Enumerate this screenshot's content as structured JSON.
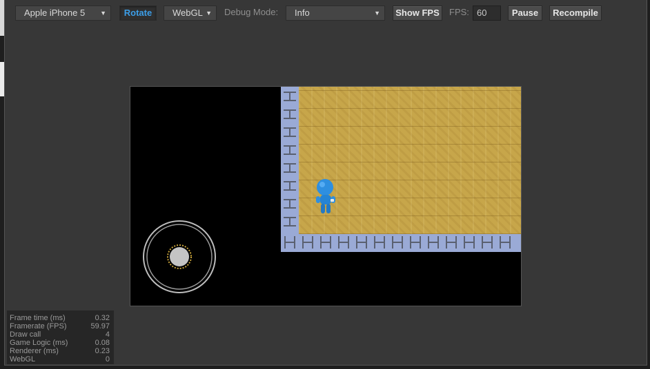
{
  "toolbar": {
    "device_select": "Apple iPhone 5",
    "rotate_label": "Rotate",
    "renderer_select": "WebGL",
    "debug_mode_label": "Debug Mode:",
    "debug_mode_select": "Info",
    "show_fps_label": "Show FPS",
    "fps_label": "FPS:",
    "fps_value": "60",
    "pause_label": "Pause",
    "recompile_label": "Recompile"
  },
  "colors": {
    "accent": "#3c9ee8",
    "floor": "#c7a64a",
    "wall": "#9aaad6",
    "character": "#2e8fe0"
  },
  "icons": {
    "dropdown": "triangle-down",
    "character": "blue-robot-character",
    "joystick": "virtual-joystick"
  },
  "stats": [
    {
      "label": "Frame time (ms)",
      "value": "0.32"
    },
    {
      "label": "Framerate (FPS)",
      "value": "59.97"
    },
    {
      "label": "Draw call",
      "value": "4"
    },
    {
      "label": "Game Logic (ms)",
      "value": "0.08"
    },
    {
      "label": "Renderer (ms)",
      "value": "0.23"
    },
    {
      "label": "WebGL",
      "value": "0"
    }
  ]
}
